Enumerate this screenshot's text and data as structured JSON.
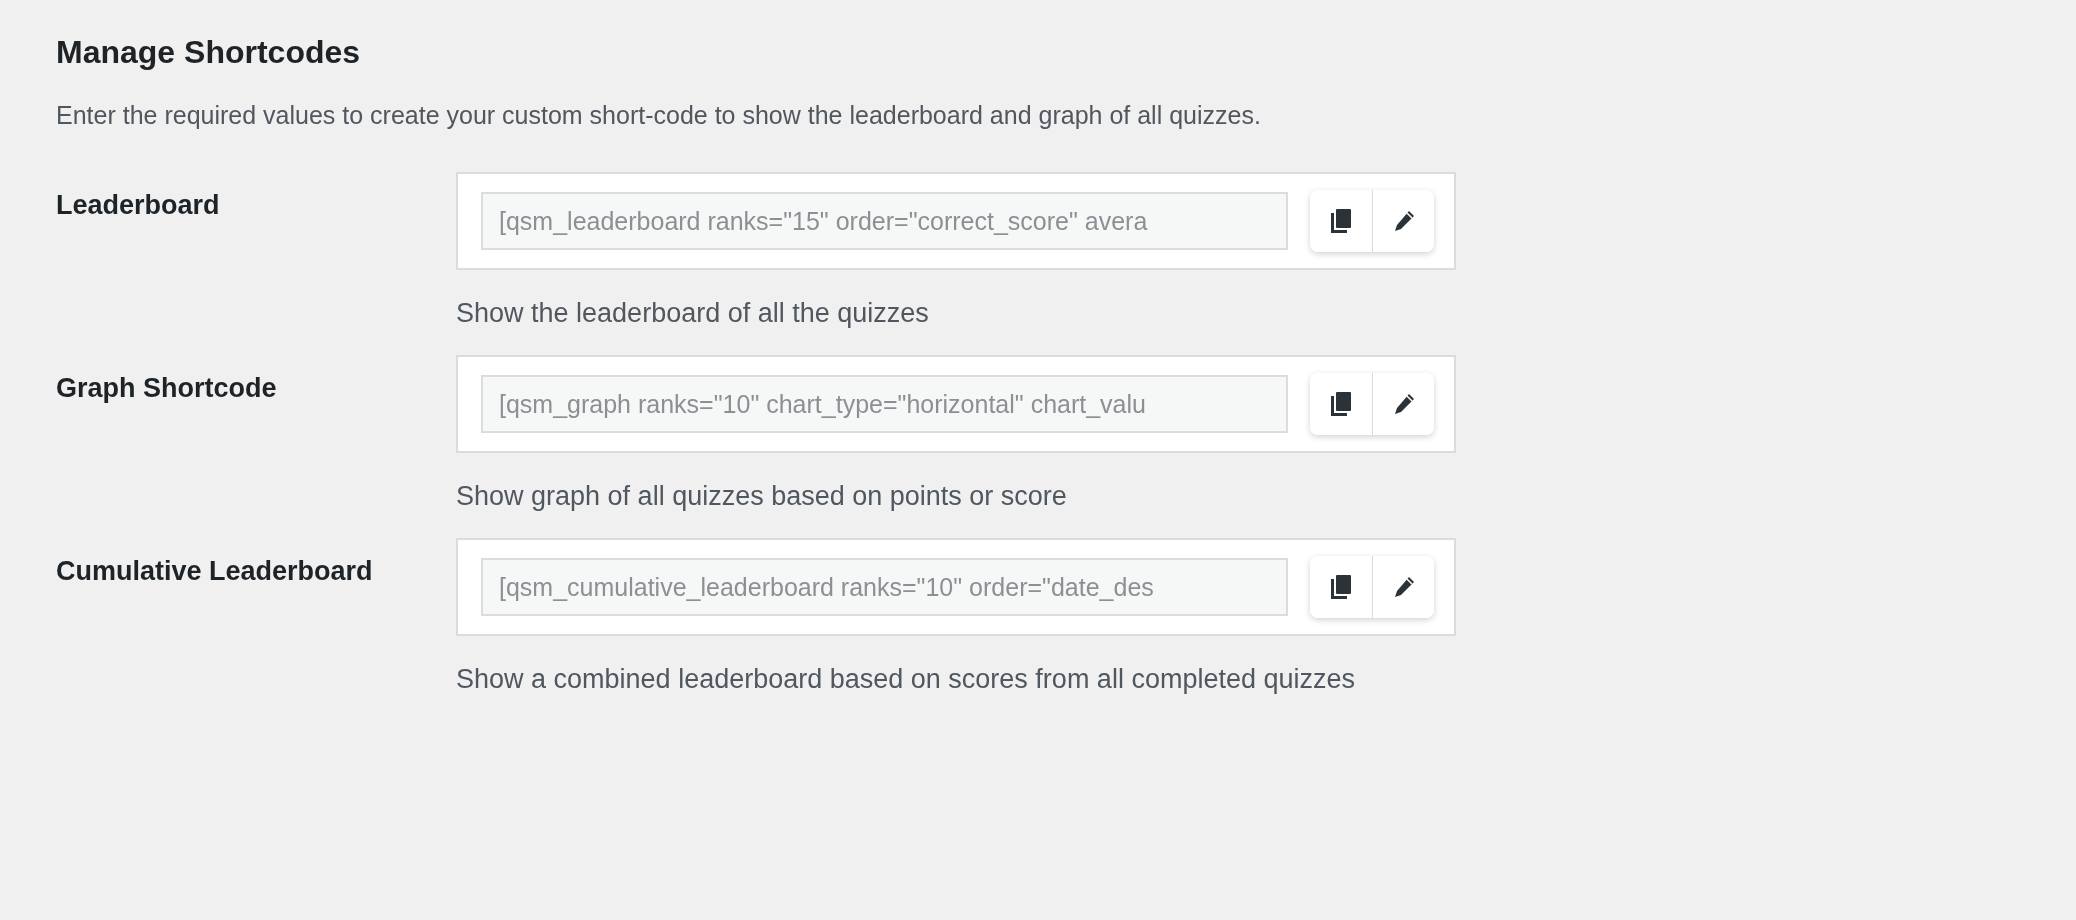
{
  "page": {
    "title": "Manage Shortcodes",
    "description": "Enter the required values to create your custom short-code to show the leaderboard and graph of all quizzes."
  },
  "shortcodes": [
    {
      "label": "Leaderboard",
      "value": "[qsm_leaderboard ranks=\"15\" order=\"correct_score\" avera",
      "help": "Show the leaderboard of all the quizzes"
    },
    {
      "label": "Graph Shortcode",
      "value": "[qsm_graph ranks=\"10\" chart_type=\"horizontal\" chart_valu",
      "help": "Show graph of all quizzes based on points or score"
    },
    {
      "label": "Cumulative Leaderboard",
      "value": "[qsm_cumulative_leaderboard ranks=\"10\" order=\"date_des",
      "help": "Show a combined leaderboard based on scores from all completed quizzes"
    }
  ]
}
